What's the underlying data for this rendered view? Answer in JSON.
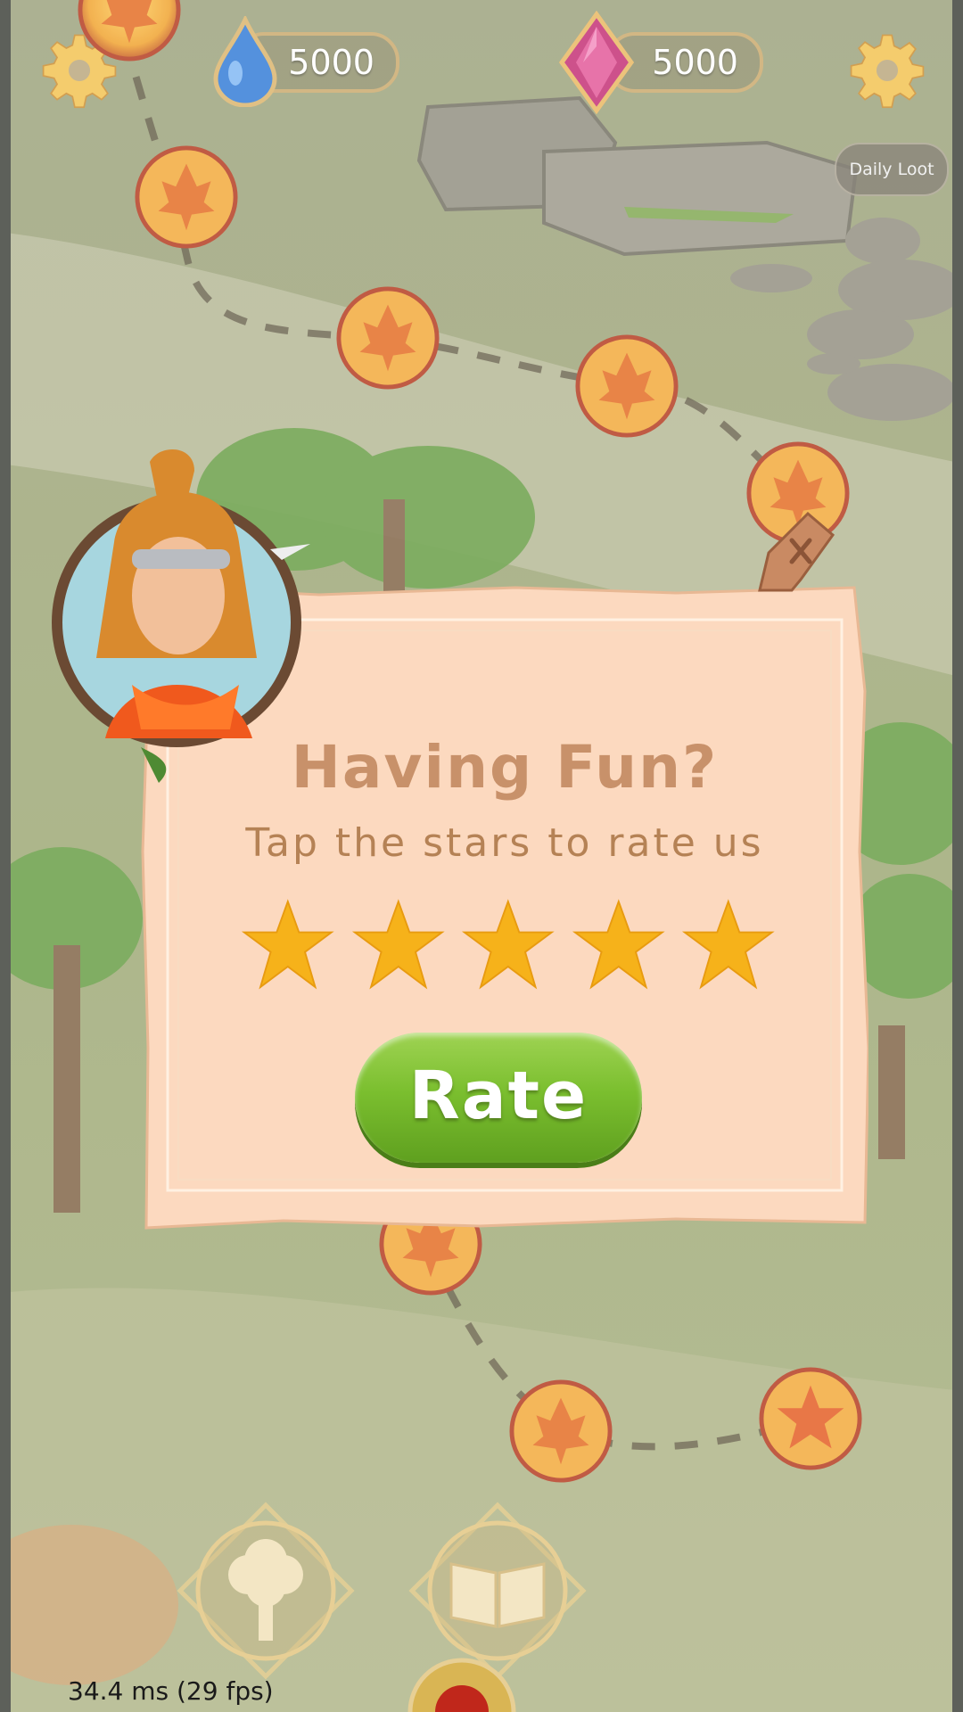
{
  "hud": {
    "water_count": "5000",
    "gem_count": "5000",
    "daily_loot_label": "Daily Loot",
    "left_icon": "gear-icon",
    "right_icon": "gear-icon"
  },
  "map": {
    "node_icon": "leaf-icon",
    "special_node_icon": "star-icon"
  },
  "dialog": {
    "title": "Having Fun?",
    "subtitle": "Tap the stars to rate us",
    "stars": 5,
    "rate_label": "Rate",
    "close_icon": "close-icon"
  },
  "bottom_nav": {
    "left_icon": "tree-icon",
    "right_icon": "book-icon"
  },
  "debug": {
    "fps_text": "34.4 ms (29 fps)"
  },
  "colors": {
    "title": "#c8916a",
    "subtitle": "#b58255",
    "rate_button": "#7bbf2f",
    "star": "#f6b21a",
    "parchment": "#fcd9bf"
  }
}
